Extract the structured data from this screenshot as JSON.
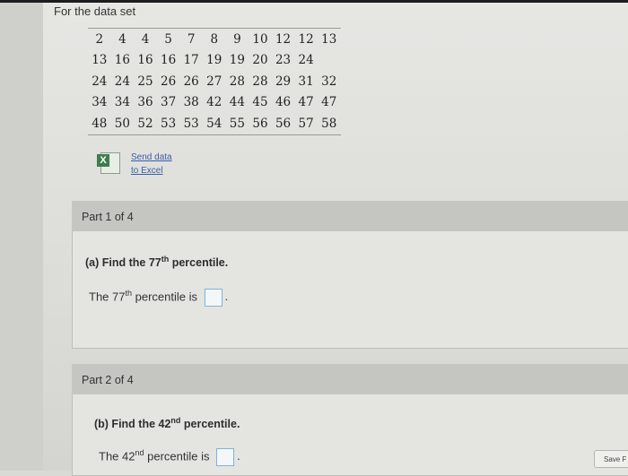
{
  "intro": {
    "text": "For the data set"
  },
  "data_rows": [
    [
      "2",
      "4",
      "4",
      "5",
      "7",
      "8",
      "9",
      "10",
      "12",
      "12",
      "13"
    ],
    [
      "13",
      "16",
      "16",
      "16",
      "17",
      "19",
      "19",
      "20",
      "23",
      "24"
    ],
    [
      "24",
      "24",
      "25",
      "26",
      "26",
      "27",
      "28",
      "28",
      "29",
      "31",
      "32"
    ],
    [
      "34",
      "34",
      "36",
      "37",
      "38",
      "42",
      "44",
      "45",
      "46",
      "47",
      "47"
    ],
    [
      "48",
      "50",
      "52",
      "53",
      "53",
      "54",
      "55",
      "56",
      "56",
      "57",
      "58"
    ]
  ],
  "excel": {
    "line1": "Send data",
    "line2": "to Excel",
    "icon": "excel-icon"
  },
  "part1": {
    "header": "Part 1 of 4",
    "question_prefix": "(a) Find the 77",
    "question_sup": "th",
    "question_suffix": " percentile.",
    "answer_prefix": "The 77",
    "answer_sup": "th",
    "answer_suffix": " percentile is",
    "answer_value": ""
  },
  "part2": {
    "header": "Part 2 of 4",
    "question_prefix": "(b) Find the 42",
    "question_sup": "nd",
    "question_suffix": " percentile.",
    "answer_prefix": "The 42",
    "answer_sup": "nd",
    "answer_suffix": " percentile is",
    "answer_value": ""
  },
  "save": {
    "label": "Save F"
  }
}
